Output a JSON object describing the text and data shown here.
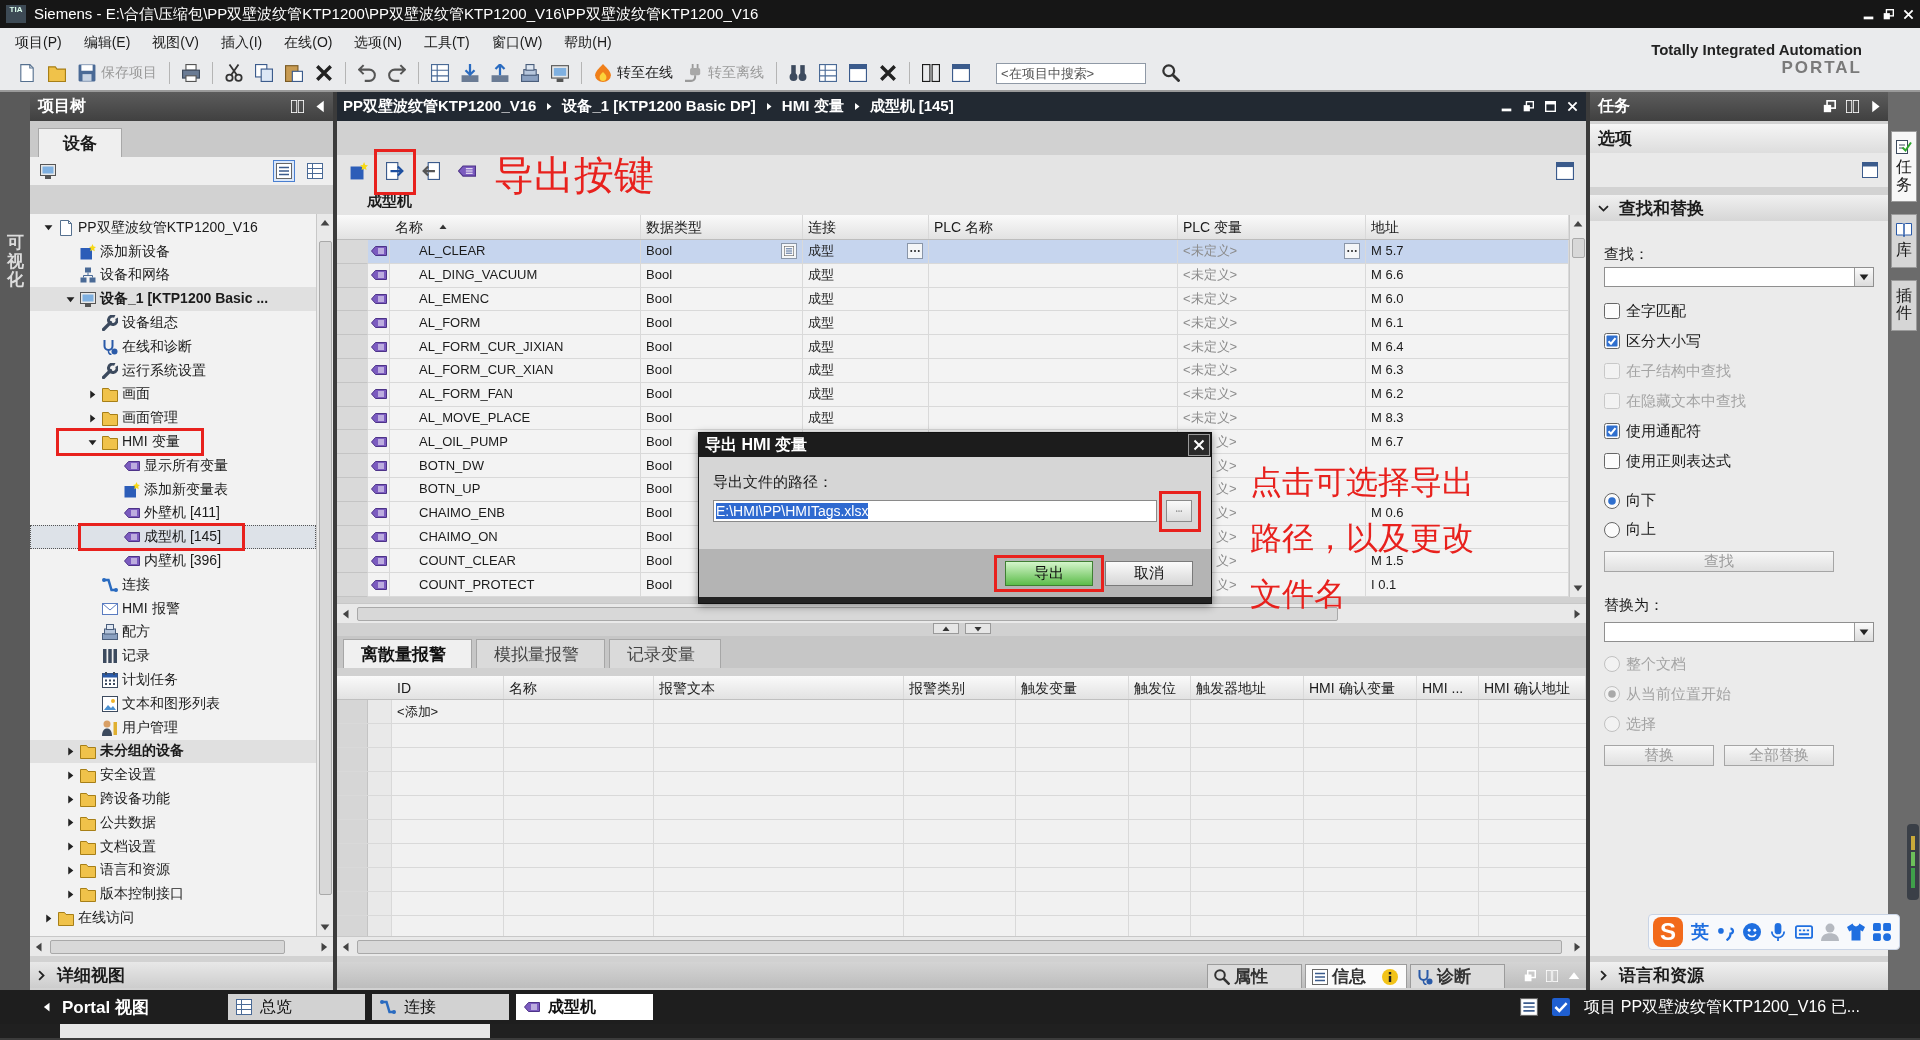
{
  "title_bar": {
    "logo": "TIA",
    "title": "Siemens - E:\\合信\\压缩包\\PP双壁波纹管KTP1200\\PP双壁波纹管KTP1200_V16\\PP双壁波纹管KTP1200_V16"
  },
  "menu": [
    "项目(P)",
    "编辑(E)",
    "视图(V)",
    "插入(I)",
    "在线(O)",
    "选项(N)",
    "工具(T)",
    "窗口(W)",
    "帮助(H)"
  ],
  "toolbar": {
    "buttons": [
      {
        "label": "保存项目",
        "disabled": true
      },
      {
        "label": "转至在线",
        "disabled": false
      },
      {
        "label": "转至离线",
        "disabled": true
      }
    ],
    "search": {
      "placeholder": "<在项目中搜索>"
    },
    "brand": "Totally Integrated Automation",
    "product": "PORTAL"
  },
  "side_strip": {
    "label": "可视化"
  },
  "project_tree": {
    "title": "项目树",
    "tab": "设备",
    "items": [
      {
        "label": "PP双壁波纹管KTP1200_V16",
        "kind": "project",
        "expanded": true,
        "selected": false,
        "highlighted": false,
        "children": [
          {
            "label": "添加新设备",
            "kind": "add",
            "selected": false,
            "highlighted": false
          },
          {
            "label": "设备和网络",
            "kind": "network",
            "selected": false,
            "highlighted": false
          },
          {
            "label": "设备_1 [KTP1200 Basic ...",
            "kind": "device",
            "expanded": true,
            "selected": false,
            "highlighted": false,
            "children": [
              {
                "label": "设备组态",
                "kind": "config",
                "selected": false,
                "highlighted": false
              },
              {
                "label": "在线和诊断",
                "kind": "diagnostics",
                "selected": false,
                "highlighted": false
              },
              {
                "label": "运行系统设置",
                "kind": "settings",
                "selected": false,
                "highlighted": false
              },
              {
                "label": "画面",
                "kind": "folder",
                "expanded": false,
                "selected": false,
                "highlighted": false
              },
              {
                "label": "画面管理",
                "kind": "folder",
                "expanded": false,
                "selected": false,
                "highlighted": false
              },
              {
                "label": "HMI 变量",
                "kind": "folder",
                "expanded": true,
                "selected": false,
                "highlighted": true,
                "children": [
                  {
                    "label": "显示所有变量",
                    "kind": "tags",
                    "selected": false,
                    "highlighted": false
                  },
                  {
                    "label": "添加新变量表",
                    "kind": "add",
                    "selected": false,
                    "highlighted": false
                  },
                  {
                    "label": "外壁机 [411]",
                    "kind": "table",
                    "selected": false,
                    "highlighted": false
                  },
                  {
                    "label": "成型机 [145]",
                    "kind": "table",
                    "selected": true,
                    "highlighted": true
                  },
                  {
                    "label": "内壁机 [396]",
                    "kind": "table",
                    "selected": false,
                    "highlighted": false
                  }
                ]
              },
              {
                "label": "连接",
                "kind": "link",
                "selected": false,
                "highlighted": false
              },
              {
                "label": "HMI 报警",
                "kind": "alarms",
                "selected": false,
                "highlighted": false
              },
              {
                "label": "配方",
                "kind": "recipes",
                "selected": false,
                "highlighted": false
              },
              {
                "label": "记录",
                "kind": "logs",
                "selected": false,
                "highlighted": false
              },
              {
                "label": "计划任务",
                "kind": "tasks",
                "selected": false,
                "highlighted": false
              },
              {
                "label": "文本和图形列表",
                "kind": "lists",
                "selected": false,
                "highlighted": false
              },
              {
                "label": "用户管理",
                "kind": "users",
                "selected": false,
                "highlighted": false
              }
            ]
          },
          {
            "label": "未分组的设备",
            "kind": "group",
            "expanded": false,
            "selected": false,
            "highlighted": false
          },
          {
            "label": "安全设置",
            "kind": "folder",
            "expanded": false,
            "selected": false,
            "highlighted": false
          },
          {
            "label": "跨设备功能",
            "kind": "folder",
            "expanded": false,
            "selected": false,
            "highlighted": false
          },
          {
            "label": "公共数据",
            "kind": "folder",
            "expanded": false,
            "selected": false,
            "highlighted": false
          },
          {
            "label": "文档设置",
            "kind": "folder",
            "expanded": false,
            "selected": false,
            "highlighted": false
          },
          {
            "label": "语言和资源",
            "kind": "folder",
            "expanded": false,
            "selected": false,
            "highlighted": false
          },
          {
            "label": "版本控制接口",
            "kind": "folder",
            "expanded": false,
            "selected": false,
            "highlighted": false
          }
        ]
      },
      {
        "label": "在线访问",
        "kind": "folder",
        "expanded": false,
        "selected": false,
        "highlighted": false
      }
    ]
  },
  "details_bar": {
    "label": "详细视图",
    "expanded": false
  },
  "editor": {
    "breadcrumb": [
      "PP双壁波纹管KTP1200_V16",
      "设备_1 [KTP1200 Basic DP]",
      "HMI 变量",
      "成型机 [145]"
    ],
    "tools": [
      {
        "highlighted": false
      },
      {
        "highlighted": true
      },
      {
        "highlighted": false
      },
      {
        "highlighted": false
      }
    ],
    "callout": "导出按键",
    "table": {
      "title": "成型机",
      "columns": [
        {
          "label": "名称",
          "sorted": true
        },
        {
          "label": "数据类型",
          "sorted": false
        },
        {
          "label": "连接",
          "sorted": false
        },
        {
          "label": "PLC 名称",
          "sorted": false
        },
        {
          "label": "PLC 变量",
          "sorted": false
        },
        {
          "label": "地址",
          "sorted": false
        }
      ],
      "rows": [
        {
          "name": "AL_CLEAR",
          "data_type": "Bool",
          "connection": "成型",
          "plc_variable": "<未定义>",
          "address": "M 5.7",
          "selected": true
        },
        {
          "name": "AL_DING_VACUUM",
          "data_type": "Bool",
          "connection": "成型",
          "plc_variable": "<未定义>",
          "address": "M 6.6",
          "selected": false
        },
        {
          "name": "AL_EMENC",
          "data_type": "Bool",
          "connection": "成型",
          "plc_variable": "<未定义>",
          "address": "M 6.0",
          "selected": false
        },
        {
          "name": "AL_FORM",
          "data_type": "Bool",
          "connection": "成型",
          "plc_variable": "<未定义>",
          "address": "M 6.1",
          "selected": false
        },
        {
          "name": "AL_FORM_CUR_JIXIAN",
          "data_type": "Bool",
          "connection": "成型",
          "plc_variable": "<未定义>",
          "address": "M 6.4",
          "selected": false
        },
        {
          "name": "AL_FORM_CUR_XIAN",
          "data_type": "Bool",
          "connection": "成型",
          "plc_variable": "<未定义>",
          "address": "M 6.3",
          "selected": false
        },
        {
          "name": "AL_FORM_FAN",
          "data_type": "Bool",
          "connection": "成型",
          "plc_variable": "<未定义>",
          "address": "M 6.2",
          "selected": false
        },
        {
          "name": "AL_MOVE_PLACE",
          "data_type": "Bool",
          "connection": "成型",
          "plc_variable": "<未定义>",
          "address": "M 8.3",
          "selected": false
        },
        {
          "name": "AL_OIL_PUMP",
          "data_type": "Bool",
          "plc_variable": "义>",
          "address": "M 6.7",
          "selected": false
        },
        {
          "name": "BOTN_DW",
          "data_type": "Bool",
          "plc_variable": "义>",
          "selected": false
        },
        {
          "name": "BOTN_UP",
          "data_type": "Bool",
          "plc_variable": "义>",
          "selected": false
        },
        {
          "name": "CHAIMO_ENB",
          "data_type": "Bool",
          "plc_variable": "义>",
          "address": "M 0.6",
          "selected": false
        },
        {
          "name": "CHAIMO_ON",
          "data_type": "Bool",
          "plc_variable": "义>",
          "selected": false
        },
        {
          "name": "COUNT_CLEAR",
          "data_type": "Bool",
          "plc_variable": "义>",
          "address": "M 1.5",
          "selected": false
        },
        {
          "name": "COUNT_PROTECT",
          "data_type": "Bool",
          "plc_variable": "义>",
          "address": "I 0.1",
          "selected": false
        }
      ]
    },
    "dialog": {
      "title": "导出 HMI 变量",
      "path_label": "导出文件的路径：",
      "path": {
        "value": "E:\\HMI\\PP\\HMITags.xlsx",
        "text_selected": true
      },
      "browse_highlighted": true,
      "buttons": [
        {
          "label": "导出",
          "kind": "primary",
          "highlighted": true
        },
        {
          "label": "取消",
          "kind": "normal",
          "highlighted": false
        }
      ]
    },
    "dialog_callout": [
      "点击可选择导出",
      "路径，以及更改",
      "文件名"
    ],
    "tabs": [
      {
        "label": "离散量报警",
        "selected": true
      },
      {
        "label": "模拟量报警",
        "selected": false
      },
      {
        "label": "记录变量",
        "selected": false
      }
    ],
    "alarm_table": {
      "columns": [
        "ID",
        "名称",
        "报警文本",
        "报警类别",
        "触发变量",
        "触发位",
        "触发器地址",
        "HMI 确认变量",
        "HMI ...",
        "HMI 确认地址"
      ],
      "add_row": "<添加>"
    }
  },
  "inspector": {
    "tabs": [
      {
        "label": "属性",
        "selected": false
      },
      {
        "label": "信息",
        "selected": true
      },
      {
        "label": "诊断",
        "selected": false
      }
    ]
  },
  "task_panel": {
    "title": "任务",
    "pane": "选项",
    "section": {
      "title": "查找和替换",
      "expanded": true
    },
    "find_label": "查找：",
    "options": [
      {
        "label": "全字匹配",
        "checked": false,
        "disabled": false
      },
      {
        "label": "区分大小写",
        "checked": true,
        "disabled": false
      },
      {
        "label": "在子结构中查找",
        "checked": false,
        "disabled": true
      },
      {
        "label": "在隐藏文本中查找",
        "checked": false,
        "disabled": true
      },
      {
        "label": "使用通配符",
        "checked": true,
        "disabled": false
      },
      {
        "label": "使用正则表达式",
        "checked": false,
        "disabled": false
      }
    ],
    "directions": [
      {
        "label": "向下",
        "selected": true
      },
      {
        "label": "向上",
        "selected": false
      }
    ],
    "find_button": {
      "label": "查找",
      "disabled": true
    },
    "replace_label": "替换为：",
    "scopes": [
      {
        "label": "整个文档",
        "selected": false,
        "disabled": true
      },
      {
        "label": "从当前位置开始",
        "selected": true,
        "disabled": true
      },
      {
        "label": "选择",
        "selected": false,
        "disabled": true
      }
    ],
    "replace_buttons": [
      {
        "label": "替换",
        "disabled": true
      },
      {
        "label": "全部替换",
        "disabled": true
      }
    ],
    "footer": {
      "title": "语言和资源",
      "expanded": false
    }
  },
  "side_tabs": [
    {
      "label": "任务",
      "selected": true
    },
    {
      "label": "库",
      "selected": false
    },
    {
      "label": "插件",
      "selected": false
    }
  ],
  "ime_toolbar": {
    "logo": "S",
    "mode": "英"
  },
  "taskbar": {
    "portal": "Portal 视图",
    "tabs": [
      {
        "label": "总览",
        "selected": false
      },
      {
        "label": "连接",
        "selected": false
      },
      {
        "label": "成型机",
        "selected": true
      }
    ],
    "status": "项目 PP双壁波纹管KTP1200_V16 已..."
  }
}
